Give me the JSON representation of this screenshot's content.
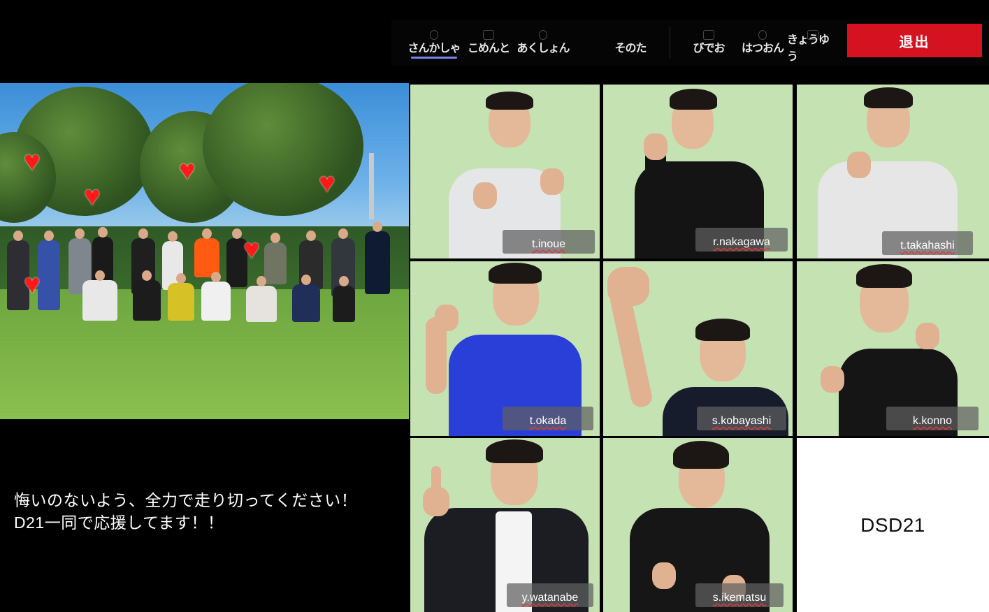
{
  "toolbar": {
    "items": [
      {
        "label": "さんかしゃ",
        "icon": "people-icon",
        "active": true
      },
      {
        "label": "こめんと",
        "icon": "chat-icon",
        "active": false
      },
      {
        "label": "あくしょん",
        "icon": "hand-icon",
        "active": false
      },
      {
        "label": "そのた",
        "icon": "more-icon",
        "active": false
      },
      {
        "label": "びでお",
        "icon": "video-off-icon",
        "active": false
      },
      {
        "label": "はつおん",
        "icon": "mic-icon",
        "active": false
      },
      {
        "label": "きょうゆう",
        "icon": "share-icon",
        "active": false
      }
    ],
    "leave_label": "退出",
    "accent_color": "#7b83eb",
    "leave_color": "#d51220"
  },
  "message": {
    "line1": "悔いのないよう、全力で走り切ってください！",
    "line2": "D21一同で応援してます！！"
  },
  "participants": [
    {
      "name": "t.inoue",
      "shirt": "#e5e6e8"
    },
    {
      "name": "r.nakagawa",
      "shirt": "#141414"
    },
    {
      "name": "t.takahashi",
      "shirt": "#e6e6e6"
    },
    {
      "name": "t.okada",
      "shirt": "#2a3fd8"
    },
    {
      "name": "s.kobayashi",
      "shirt": "#161c2c"
    },
    {
      "name": "k.konno",
      "shirt": "#151515"
    },
    {
      "name": "y.watanabe",
      "shirt": "#1b1d22"
    },
    {
      "name": "s.ikematsu",
      "shirt": "#161616"
    }
  ],
  "blank_tile": {
    "label": "DSD21"
  },
  "tile_bg_color": "#c5e2b3",
  "heart_color": "#ff1a1a"
}
